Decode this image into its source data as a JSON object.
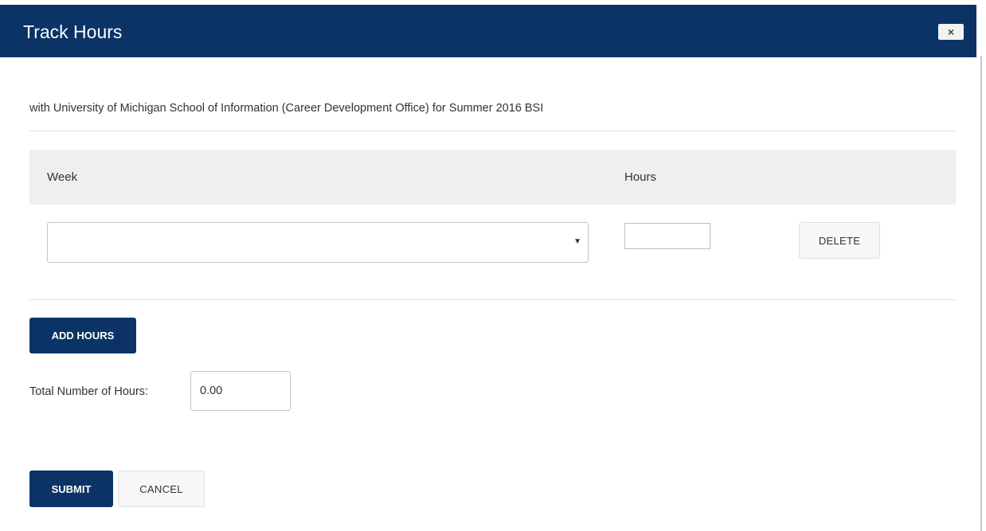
{
  "dialog": {
    "title": "Track Hours",
    "close_label": "×",
    "subtitle": "with University of Michigan School of Information (Career Development Office) for Summer 2016 BSI"
  },
  "table": {
    "headers": {
      "week": "Week",
      "hours": "Hours"
    },
    "rows": [
      {
        "week_value": "",
        "hours_value": "",
        "delete_label": "DELETE"
      }
    ]
  },
  "actions": {
    "add_hours_label": "ADD HOURS",
    "submit_label": "SUBMIT",
    "cancel_label": "CANCEL"
  },
  "total": {
    "label": "Total Number of Hours:",
    "value": "0.00"
  },
  "icons": {
    "close": "close-icon",
    "dropdown": "chevron-down-icon"
  },
  "colors": {
    "header_bg": "#0b3366",
    "primary_button": "#0b3366",
    "table_header_bg": "#efefef"
  }
}
